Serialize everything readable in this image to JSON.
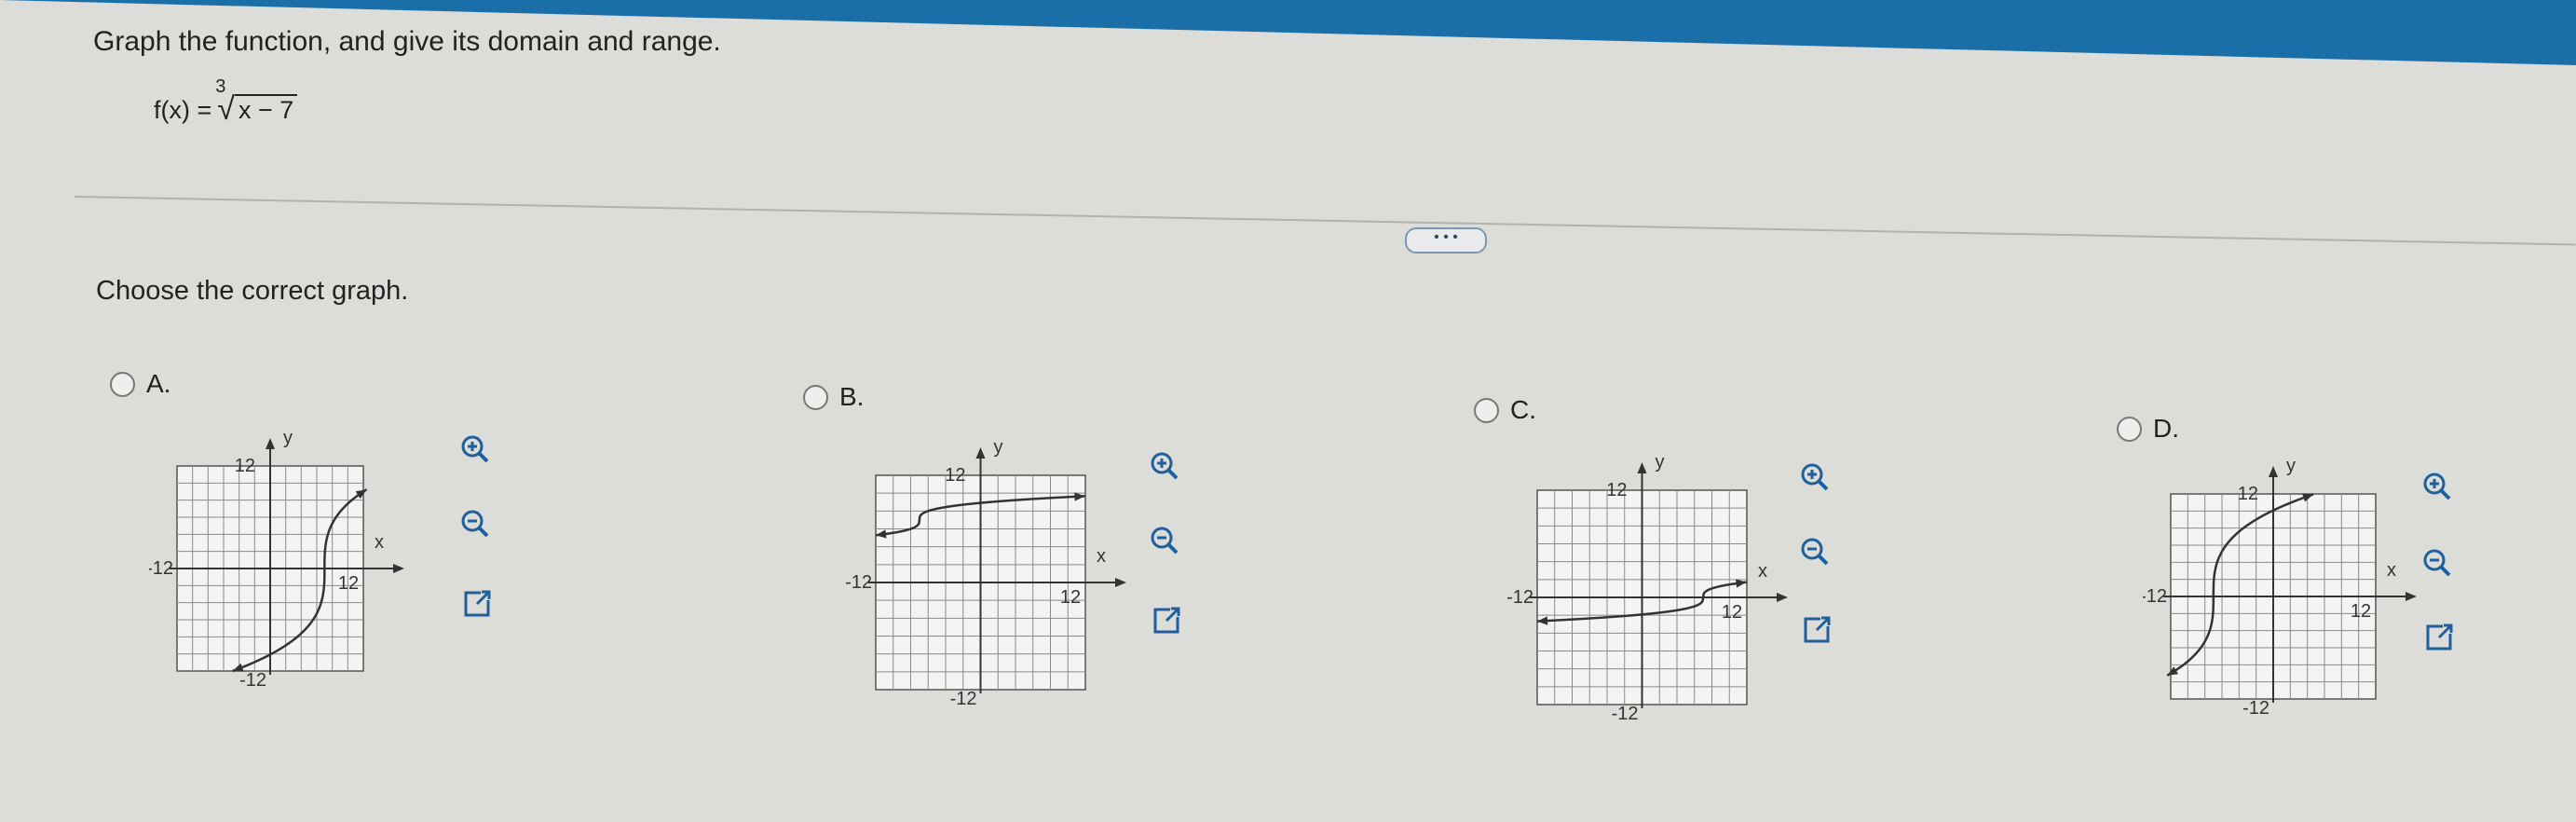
{
  "question": {
    "prompt": "Graph the function, and give its domain and range.",
    "function_lhs": "f(x) =",
    "root_index": "3",
    "radicand": "x − 7"
  },
  "more_button": "• • •",
  "instruction": "Choose the correct graph.",
  "options": [
    {
      "letter": "A.",
      "curve": "vertical-steep",
      "label_top": "12",
      "label_bottom": "-12",
      "label_left": "-12",
      "label_right": "12",
      "axis_x": "x",
      "axis_y": "y"
    },
    {
      "letter": "B.",
      "curve": "horizontal-upper",
      "label_top": "12",
      "label_bottom": "-12",
      "label_left": "-12",
      "label_right": "12",
      "axis_x": "x",
      "axis_y": "y"
    },
    {
      "letter": "C.",
      "curve": "horizontal-lower",
      "label_top": "12",
      "label_bottom": "-12",
      "label_left": "-12",
      "label_right": "12",
      "axis_x": "x",
      "axis_y": "y"
    },
    {
      "letter": "D.",
      "curve": "vertical-left",
      "label_top": "12",
      "label_bottom": "-12",
      "label_left": "-12",
      "label_right": "12",
      "axis_x": "x",
      "axis_y": "y"
    }
  ],
  "tools": [
    "zoom-in-icon",
    "zoom-out-icon",
    "open-external-icon"
  ]
}
